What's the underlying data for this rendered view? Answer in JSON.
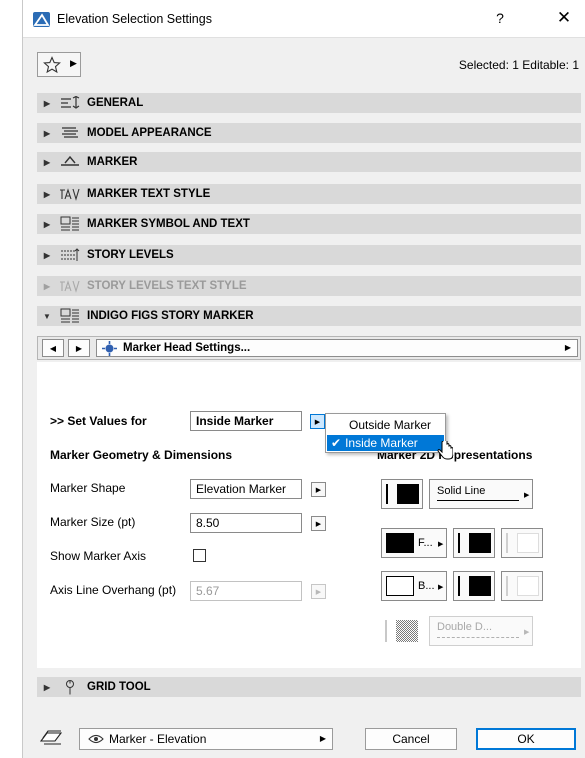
{
  "window": {
    "title": "Elevation Selection Settings",
    "help_label": "?",
    "close_label": "✕"
  },
  "header": {
    "selected_info": "Selected: 1 Editable: 1"
  },
  "panels": [
    {
      "label": "GENERAL",
      "icon": "general-settings-icon",
      "state": "collapsed"
    },
    {
      "label": "MODEL APPEARANCE",
      "icon": "model-appearance-icon",
      "state": "collapsed"
    },
    {
      "label": "MARKER",
      "icon": "marker-icon",
      "state": "collapsed"
    },
    {
      "label": "MARKER TEXT STYLE",
      "icon": "text-style-icon",
      "state": "collapsed"
    },
    {
      "label": "MARKER SYMBOL AND TEXT",
      "icon": "symbol-text-icon",
      "state": "collapsed"
    },
    {
      "label": "STORY LEVELS",
      "icon": "story-levels-icon",
      "state": "collapsed"
    },
    {
      "label": "STORY LEVELS TEXT STYLE",
      "icon": "text-style-icon",
      "state": "disabled"
    },
    {
      "label": "INDIGO FIGS STORY MARKER",
      "icon": "symbol-text-icon",
      "state": "expanded"
    }
  ],
  "nav": {
    "head_settings_label": "Marker Head Settings..."
  },
  "content": {
    "set_values_label": ">> Set Values for",
    "set_values_value": "Inside Marker",
    "geometry_heading": "Marker Geometry & Dimensions",
    "representations_heading": "Marker 2D Representations",
    "marker_shape_label": "Marker Shape",
    "marker_shape_value": "Elevation Marker",
    "marker_size_label": "Marker Size (pt)",
    "marker_size_value": "8.50",
    "show_axis_label": "Show Marker Axis",
    "axis_overhang_label": "Axis Line Overhang (pt)",
    "axis_overhang_value": "5.67",
    "line_type_value": "Solid Line",
    "fill_label": "F...",
    "background_label": "B...",
    "axis_line_type_value": "Double D..."
  },
  "dropdown": {
    "options": [
      "Outside Marker",
      "Inside Marker"
    ],
    "selected": "Inside Marker"
  },
  "grid_tool": {
    "label": "GRID TOOL"
  },
  "footer": {
    "view_value": "Marker - Elevation",
    "cancel_label": "Cancel",
    "ok_label": "OK"
  },
  "colors": {
    "accent": "#0078d7",
    "panel_bg": "#d9d9d9"
  }
}
